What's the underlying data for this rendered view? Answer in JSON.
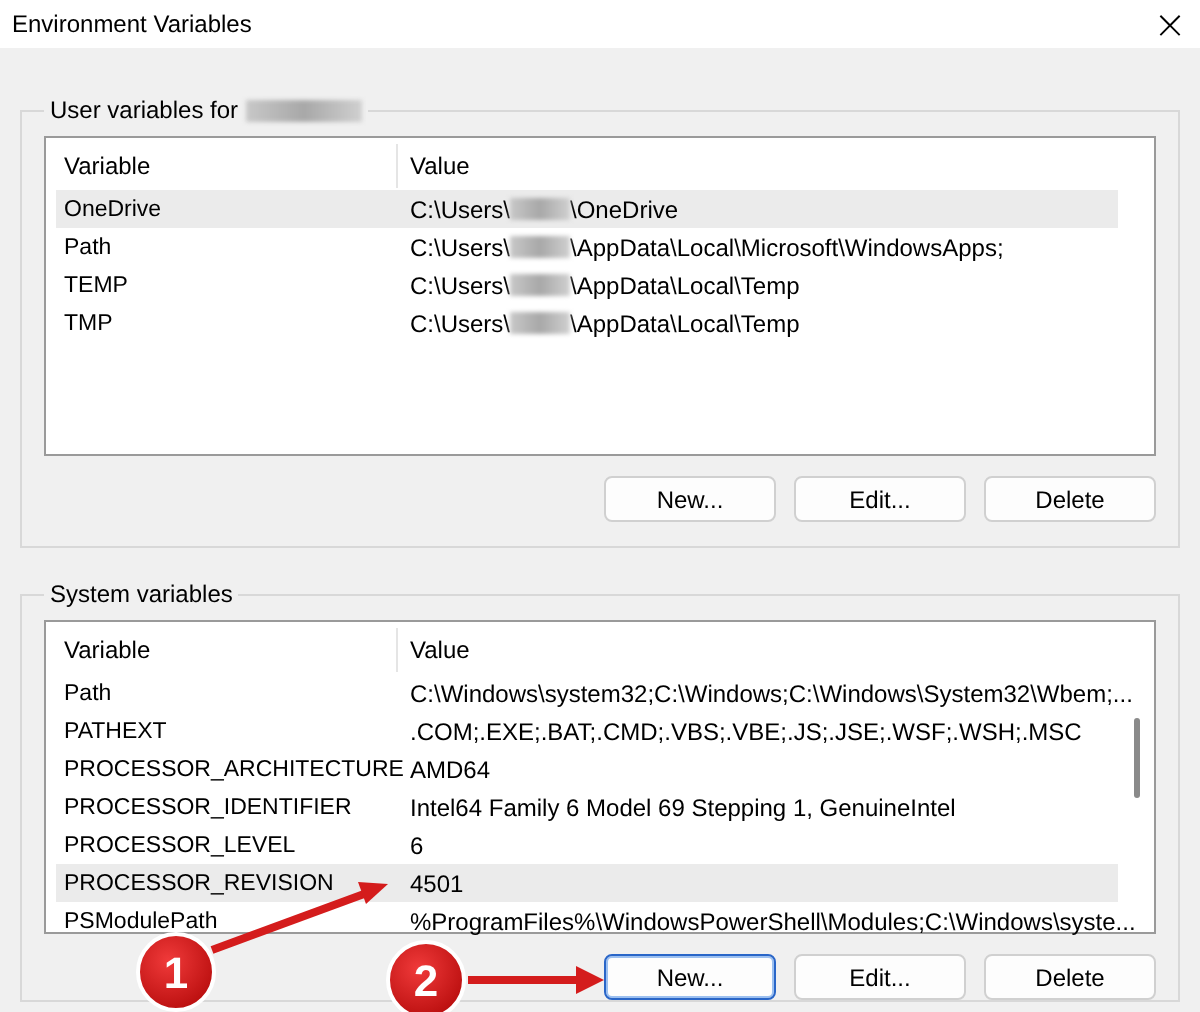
{
  "window": {
    "title": "Environment Variables",
    "close": "×"
  },
  "groups": [
    {
      "title": "User variables for",
      "title_redacted": true,
      "columns": [
        "Variable",
        "Value"
      ],
      "scrollbar": false,
      "rows": [
        {
          "name": "OneDrive",
          "value": "C:\\Users\\",
          "redacted": true,
          "value_end": "\\OneDrive",
          "selected": true
        },
        {
          "name": "Path",
          "value": "C:\\Users\\",
          "redacted": true,
          "value_end": "\\AppData\\Local\\Microsoft\\WindowsApps;",
          "selected": false
        },
        {
          "name": "TEMP",
          "value": "C:\\Users\\",
          "redacted": true,
          "value_end": "\\AppData\\Local\\Temp",
          "selected": false
        },
        {
          "name": "TMP",
          "value": "C:\\Users\\",
          "redacted": true,
          "value_end": "\\AppData\\Local\\Temp",
          "selected": false
        }
      ],
      "buttons": [
        {
          "label": "New...",
          "focused": false
        },
        {
          "label": "Edit...",
          "focused": false
        },
        {
          "label": "Delete",
          "focused": false
        }
      ]
    },
    {
      "title": "System variables",
      "columns": [
        "Variable",
        "Value"
      ],
      "scrollbar": true,
      "rows": [
        {
          "name": "Path",
          "value": "C:\\Windows\\system32;C:\\Windows;C:\\Windows\\System32\\Wbem;...",
          "redacted": false,
          "selected": false
        },
        {
          "name": "PATHEXT",
          "value": ".COM;.EXE;.BAT;.CMD;.VBS;.VBE;.JS;.JSE;.WSF;.WSH;.MSC",
          "redacted": false,
          "selected": false
        },
        {
          "name": "PROCESSOR_ARCHITECTURE",
          "value": "AMD64",
          "redacted": false,
          "selected": false
        },
        {
          "name": "PROCESSOR_IDENTIFIER",
          "value": "Intel64 Family 6 Model 69 Stepping 1, GenuineIntel",
          "redacted": false,
          "selected": false
        },
        {
          "name": "PROCESSOR_LEVEL",
          "value": "6",
          "redacted": false,
          "selected": false
        },
        {
          "name": "PROCESSOR_REVISION",
          "value": "4501",
          "redacted": false,
          "selected": true
        },
        {
          "name": "PSModulePath",
          "value": "%ProgramFiles%\\WindowsPowerShell\\Modules;C:\\Windows\\syste...",
          "redacted": false,
          "selected": false
        }
      ],
      "buttons": [
        {
          "label": "New...",
          "focused": true
        },
        {
          "label": "Edit...",
          "focused": false
        },
        {
          "label": "Delete",
          "focused": false
        }
      ]
    }
  ],
  "callouts": [
    {
      "number": "1"
    },
    {
      "number": "2"
    }
  ]
}
